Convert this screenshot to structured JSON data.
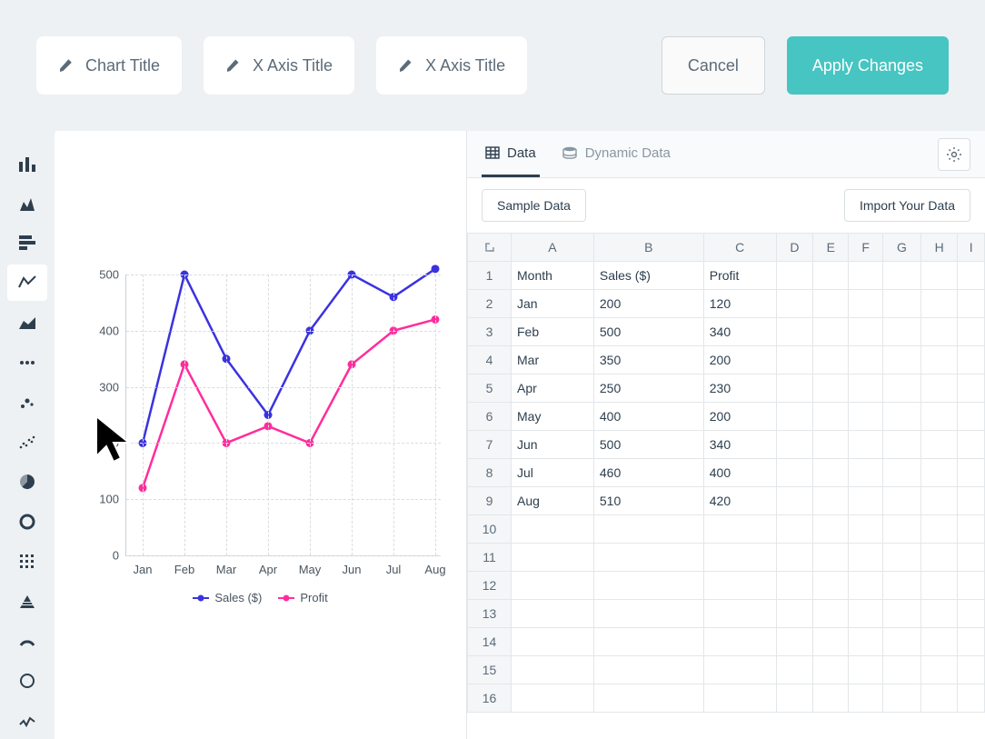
{
  "toolbar": {
    "chart_title_placeholder": "Chart Title",
    "x_axis_placeholder": "X Axis Title",
    "y_axis_placeholder": "X Axis Title",
    "cancel_label": "Cancel",
    "apply_label": "Apply Changes"
  },
  "data_panel": {
    "tab_data": "Data",
    "tab_dynamic": "Dynamic Data",
    "sample_button": "Sample Data",
    "import_button": "Import Your Data",
    "columns": [
      "A",
      "B",
      "C",
      "D",
      "E",
      "F",
      "G",
      "H",
      "I"
    ],
    "rows": [
      [
        "Month",
        "Sales ($)",
        "Profit",
        "",
        "",
        "",
        "",
        "",
        ""
      ],
      [
        "Jan",
        "200",
        "120",
        "",
        "",
        "",
        "",
        "",
        ""
      ],
      [
        "Feb",
        "500",
        "340",
        "",
        "",
        "",
        "",
        "",
        ""
      ],
      [
        "Mar",
        "350",
        "200",
        "",
        "",
        "",
        "",
        "",
        ""
      ],
      [
        "Apr",
        "250",
        "230",
        "",
        "",
        "",
        "",
        "",
        ""
      ],
      [
        "May",
        "400",
        "200",
        "",
        "",
        "",
        "",
        "",
        ""
      ],
      [
        "Jun",
        "500",
        "340",
        "",
        "",
        "",
        "",
        "",
        ""
      ],
      [
        "Jul",
        "460",
        "400",
        "",
        "",
        "",
        "",
        "",
        ""
      ],
      [
        "Aug",
        "510",
        "420",
        "",
        "",
        "",
        "",
        "",
        ""
      ],
      [
        "",
        "",
        "",
        "",
        "",
        "",
        "",
        "",
        ""
      ],
      [
        "",
        "",
        "",
        "",
        "",
        "",
        "",
        "",
        ""
      ],
      [
        "",
        "",
        "",
        "",
        "",
        "",
        "",
        "",
        ""
      ],
      [
        "",
        "",
        "",
        "",
        "",
        "",
        "",
        "",
        ""
      ],
      [
        "",
        "",
        "",
        "",
        "",
        "",
        "",
        "",
        ""
      ],
      [
        "",
        "",
        "",
        "",
        "",
        "",
        "",
        "",
        ""
      ],
      [
        "",
        "",
        "",
        "",
        "",
        "",
        "",
        "",
        ""
      ]
    ],
    "total_rows": 16
  },
  "chart_data": {
    "type": "line",
    "categories": [
      "Jan",
      "Feb",
      "Mar",
      "Apr",
      "May",
      "Jun",
      "Jul",
      "Aug"
    ],
    "series": [
      {
        "name": "Sales ($)",
        "color": "#3a32e0",
        "values": [
          200,
          500,
          350,
          250,
          400,
          500,
          460,
          510
        ]
      },
      {
        "name": "Profit",
        "color": "#ff2d9c",
        "values": [
          120,
          340,
          200,
          230,
          200,
          340,
          400,
          420
        ]
      }
    ],
    "ylim": [
      0,
      500
    ],
    "y_ticks": [
      0,
      100,
      200,
      300,
      400,
      500
    ]
  },
  "colors": {
    "sales": "#3a32e0",
    "profit": "#ff2d9c"
  }
}
